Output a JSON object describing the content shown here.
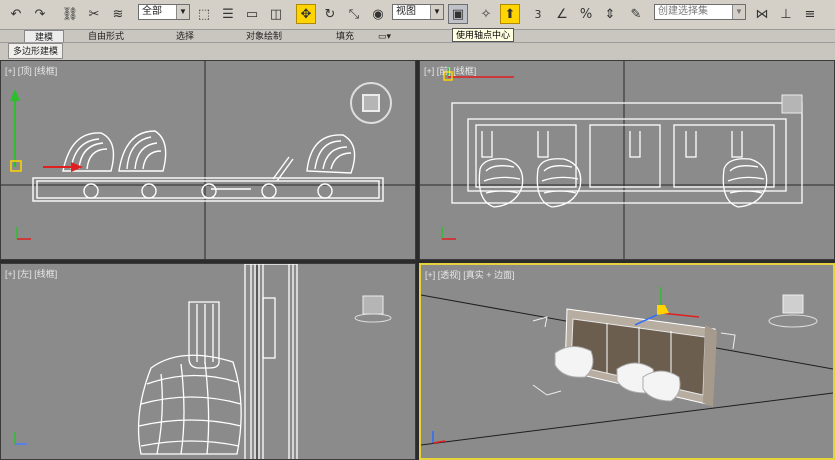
{
  "toolbar": {
    "filter_value": "全部",
    "view_value": "视图",
    "selection_set_placeholder": "创建选择集",
    "angle_snap_number": "3",
    "tooltip": "使用轴点中心"
  },
  "ribbon": {
    "tabs": [
      "建模",
      "自由形式",
      "选择",
      "对象绘制",
      "填充"
    ],
    "subtab": "多边形建模"
  },
  "viewports": {
    "top": {
      "label": "[+] [顶] [线框]"
    },
    "front": {
      "label": "[+] [前] [线框]"
    },
    "left": {
      "label": "[+] [左] [线框]"
    },
    "perspective": {
      "label": "[+] [透视] [真实 + 边面]"
    }
  },
  "colors": {
    "viewport_bg": "#8b8b8b",
    "active_border": "#e6d23a",
    "wire": "#ffffff",
    "toolbar_bg": "#d4d0c8"
  }
}
